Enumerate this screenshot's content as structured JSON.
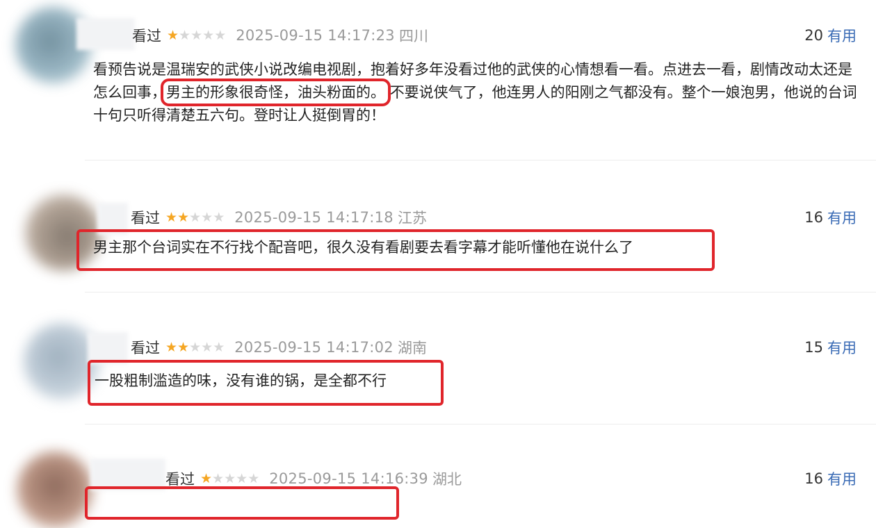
{
  "reviews": [
    {
      "seen_label": "看过",
      "stars": 1,
      "time": "2025-09-15 14:17:23",
      "region": "四川",
      "useful_count": "20",
      "useful_label": "有用",
      "content_before": "看预告说是温瑞安的武侠小说改编电视剧，抱着好多年没看过他的武侠的心情想看一看。点进去一看，剧情改动太还是怎么回事，",
      "content_highlight": "男主的形象很奇怪，油头粉面的。",
      "content_after": "不要说侠气了，他连男人的阳刚之气都没有。整个一娘泡男，他说的台词十句只听得清楚五六句。登时让人挺倒胃的！"
    },
    {
      "seen_label": "看过",
      "stars": 2,
      "time": "2025-09-15 14:17:18",
      "region": "江苏",
      "useful_count": "16",
      "useful_label": "有用",
      "content": "男主那个台词实在不行找个配音吧，很久没有看剧要去看字幕才能听懂他在说什么了"
    },
    {
      "seen_label": "看过",
      "stars": 2,
      "time": "2025-09-15 14:17:02",
      "region": "湖南",
      "useful_count": "15",
      "useful_label": "有用",
      "content": "一股粗制滥造的味，没有谁的锅，是全都不行"
    },
    {
      "seen_label": "看过",
      "stars": 1,
      "time": "2025-09-15 14:16:39",
      "region": "湖北",
      "useful_count": "16",
      "useful_label": "有用",
      "content": ""
    }
  ],
  "colors": {
    "highlight": "#e0252b",
    "star_on": "#f5a623",
    "star_off": "#d6d6d6",
    "useful_link": "#3a6bb5"
  }
}
